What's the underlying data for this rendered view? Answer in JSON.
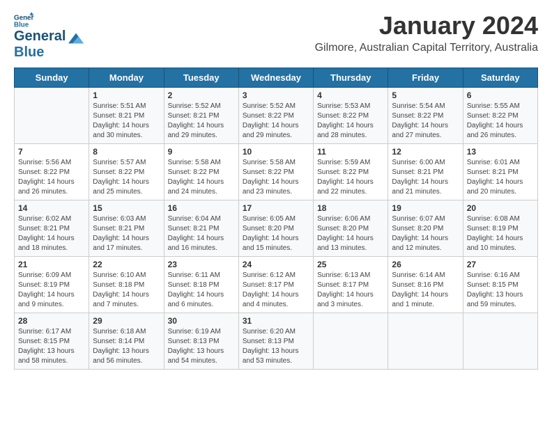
{
  "header": {
    "logo_line1": "General",
    "logo_line2": "Blue",
    "month": "January 2024",
    "location": "Gilmore, Australian Capital Territory, Australia"
  },
  "days_of_week": [
    "Sunday",
    "Monday",
    "Tuesday",
    "Wednesday",
    "Thursday",
    "Friday",
    "Saturday"
  ],
  "weeks": [
    [
      {
        "day": "",
        "detail": ""
      },
      {
        "day": "1",
        "detail": "Sunrise: 5:51 AM\nSunset: 8:21 PM\nDaylight: 14 hours\nand 30 minutes."
      },
      {
        "day": "2",
        "detail": "Sunrise: 5:52 AM\nSunset: 8:21 PM\nDaylight: 14 hours\nand 29 minutes."
      },
      {
        "day": "3",
        "detail": "Sunrise: 5:52 AM\nSunset: 8:22 PM\nDaylight: 14 hours\nand 29 minutes."
      },
      {
        "day": "4",
        "detail": "Sunrise: 5:53 AM\nSunset: 8:22 PM\nDaylight: 14 hours\nand 28 minutes."
      },
      {
        "day": "5",
        "detail": "Sunrise: 5:54 AM\nSunset: 8:22 PM\nDaylight: 14 hours\nand 27 minutes."
      },
      {
        "day": "6",
        "detail": "Sunrise: 5:55 AM\nSunset: 8:22 PM\nDaylight: 14 hours\nand 26 minutes."
      }
    ],
    [
      {
        "day": "7",
        "detail": "Sunrise: 5:56 AM\nSunset: 8:22 PM\nDaylight: 14 hours\nand 26 minutes."
      },
      {
        "day": "8",
        "detail": "Sunrise: 5:57 AM\nSunset: 8:22 PM\nDaylight: 14 hours\nand 25 minutes."
      },
      {
        "day": "9",
        "detail": "Sunrise: 5:58 AM\nSunset: 8:22 PM\nDaylight: 14 hours\nand 24 minutes."
      },
      {
        "day": "10",
        "detail": "Sunrise: 5:58 AM\nSunset: 8:22 PM\nDaylight: 14 hours\nand 23 minutes."
      },
      {
        "day": "11",
        "detail": "Sunrise: 5:59 AM\nSunset: 8:22 PM\nDaylight: 14 hours\nand 22 minutes."
      },
      {
        "day": "12",
        "detail": "Sunrise: 6:00 AM\nSunset: 8:21 PM\nDaylight: 14 hours\nand 21 minutes."
      },
      {
        "day": "13",
        "detail": "Sunrise: 6:01 AM\nSunset: 8:21 PM\nDaylight: 14 hours\nand 20 minutes."
      }
    ],
    [
      {
        "day": "14",
        "detail": "Sunrise: 6:02 AM\nSunset: 8:21 PM\nDaylight: 14 hours\nand 18 minutes."
      },
      {
        "day": "15",
        "detail": "Sunrise: 6:03 AM\nSunset: 8:21 PM\nDaylight: 14 hours\nand 17 minutes."
      },
      {
        "day": "16",
        "detail": "Sunrise: 6:04 AM\nSunset: 8:21 PM\nDaylight: 14 hours\nand 16 minutes."
      },
      {
        "day": "17",
        "detail": "Sunrise: 6:05 AM\nSunset: 8:20 PM\nDaylight: 14 hours\nand 15 minutes."
      },
      {
        "day": "18",
        "detail": "Sunrise: 6:06 AM\nSunset: 8:20 PM\nDaylight: 14 hours\nand 13 minutes."
      },
      {
        "day": "19",
        "detail": "Sunrise: 6:07 AM\nSunset: 8:20 PM\nDaylight: 14 hours\nand 12 minutes."
      },
      {
        "day": "20",
        "detail": "Sunrise: 6:08 AM\nSunset: 8:19 PM\nDaylight: 14 hours\nand 10 minutes."
      }
    ],
    [
      {
        "day": "21",
        "detail": "Sunrise: 6:09 AM\nSunset: 8:19 PM\nDaylight: 14 hours\nand 9 minutes."
      },
      {
        "day": "22",
        "detail": "Sunrise: 6:10 AM\nSunset: 8:18 PM\nDaylight: 14 hours\nand 7 minutes."
      },
      {
        "day": "23",
        "detail": "Sunrise: 6:11 AM\nSunset: 8:18 PM\nDaylight: 14 hours\nand 6 minutes."
      },
      {
        "day": "24",
        "detail": "Sunrise: 6:12 AM\nSunset: 8:17 PM\nDaylight: 14 hours\nand 4 minutes."
      },
      {
        "day": "25",
        "detail": "Sunrise: 6:13 AM\nSunset: 8:17 PM\nDaylight: 14 hours\nand 3 minutes."
      },
      {
        "day": "26",
        "detail": "Sunrise: 6:14 AM\nSunset: 8:16 PM\nDaylight: 14 hours\nand 1 minute."
      },
      {
        "day": "27",
        "detail": "Sunrise: 6:16 AM\nSunset: 8:15 PM\nDaylight: 13 hours\nand 59 minutes."
      }
    ],
    [
      {
        "day": "28",
        "detail": "Sunrise: 6:17 AM\nSunset: 8:15 PM\nDaylight: 13 hours\nand 58 minutes."
      },
      {
        "day": "29",
        "detail": "Sunrise: 6:18 AM\nSunset: 8:14 PM\nDaylight: 13 hours\nand 56 minutes."
      },
      {
        "day": "30",
        "detail": "Sunrise: 6:19 AM\nSunset: 8:13 PM\nDaylight: 13 hours\nand 54 minutes."
      },
      {
        "day": "31",
        "detail": "Sunrise: 6:20 AM\nSunset: 8:13 PM\nDaylight: 13 hours\nand 53 minutes."
      },
      {
        "day": "",
        "detail": ""
      },
      {
        "day": "",
        "detail": ""
      },
      {
        "day": "",
        "detail": ""
      }
    ]
  ]
}
